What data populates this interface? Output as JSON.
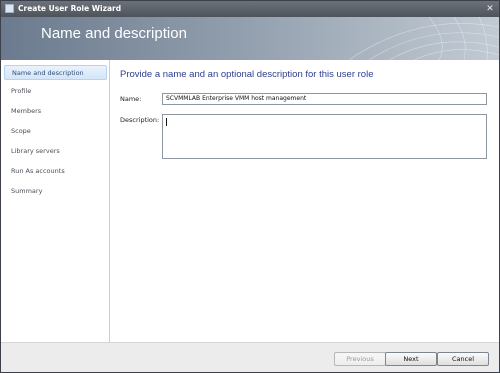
{
  "window": {
    "title": "Create User Role Wizard",
    "close_glyph": "✕"
  },
  "header": {
    "title": "Name and description"
  },
  "sidebar": {
    "items": [
      {
        "label": "Name and description",
        "active": true
      },
      {
        "label": "Profile"
      },
      {
        "label": "Members"
      },
      {
        "label": "Scope"
      },
      {
        "label": "Library servers"
      },
      {
        "label": "Run As accounts"
      },
      {
        "label": "Summary"
      }
    ]
  },
  "main": {
    "heading": "Provide a name and an optional description for this user role",
    "name_label": "Name:",
    "name_value": "SCVMMLAB Enterprise VMM host management",
    "description_label": "Description:",
    "description_value": ""
  },
  "footer": {
    "previous": "Previous",
    "next": "Next",
    "cancel": "Cancel"
  },
  "colors": {
    "accent": "#2f3e8f",
    "header_start": "#6b7a8e",
    "selected_nav": "#d4e6f8"
  }
}
